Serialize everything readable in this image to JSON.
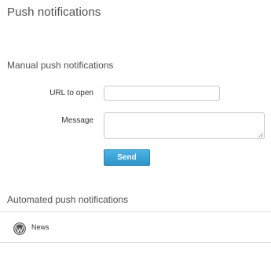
{
  "page": {
    "title": "Push notifications"
  },
  "manual": {
    "section_title": "Manual push notifications",
    "url_label": "URL to open",
    "url_value": "",
    "message_label": "Message",
    "message_value": "",
    "send_label": "Send"
  },
  "automated": {
    "section_title": "Automated push notifications",
    "items": [
      {
        "label": "News",
        "icon": "wordpress-icon"
      }
    ]
  },
  "colors": {
    "send_button": "#3aa0d6",
    "divider": "#dcdcdc"
  }
}
